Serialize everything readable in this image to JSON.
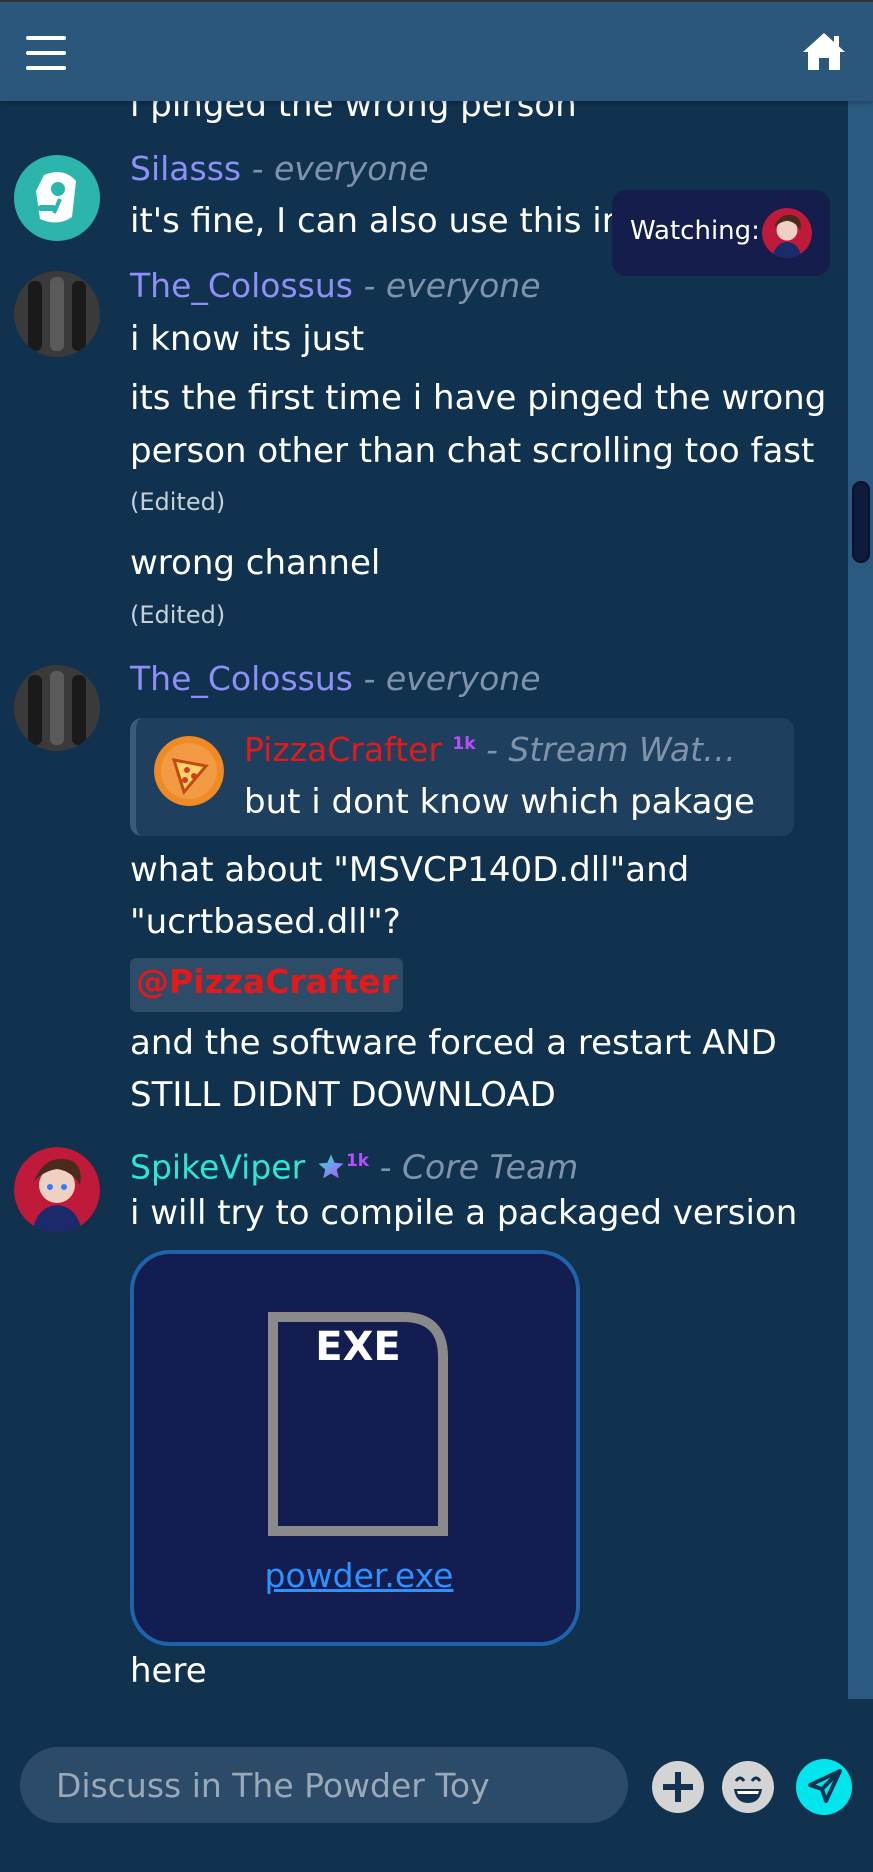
{
  "header": {
    "menu_icon": "hamburger-menu-icon",
    "home_icon": "home-icon"
  },
  "watching": {
    "label": "Watching:"
  },
  "messages": {
    "m0": {
      "text": "i pinged the wrong person"
    },
    "m1": {
      "author": "Silasss",
      "role": " - everyone",
      "text": "it's fine, I can also use this info"
    },
    "m2": {
      "author": "The_Colossus",
      "role": " - everyone",
      "lines": [
        "i know its just",
        "its the first time i have pinged the wrong",
        "person other than chat scrolling too fast",
        "wrong channel"
      ],
      "edited": "(Edited)"
    },
    "m3": {
      "author": "The_Colossus",
      "role": " - everyone",
      "quote": {
        "author": "PizzaCrafter",
        "badge": "1k",
        "role": " - Stream Wat…",
        "text": "but i dont know which pakage"
      },
      "lines": [
        "what about \"MSVCP140D.dll\"and",
        "\"ucrtbased.dll\"?",
        "and the software forced a restart AND",
        "STILL DIDNT DOWNLOAD"
      ],
      "mention": "@PizzaCrafter"
    },
    "m4": {
      "author": "SpikeViper",
      "badge": "1k",
      "role": " - Core Team",
      "text": "i will try to compile a packaged version",
      "file": {
        "ext": "EXE",
        "name": "powder.exe"
      },
      "after": "here"
    }
  },
  "composer": {
    "placeholder": "Discuss in The Powder Toy"
  },
  "colors": {
    "name": "#8f8ff8",
    "teal": "#2ee6d6",
    "mention": "#e41919",
    "link": "#2c92ff",
    "send": "#00e5ee"
  }
}
